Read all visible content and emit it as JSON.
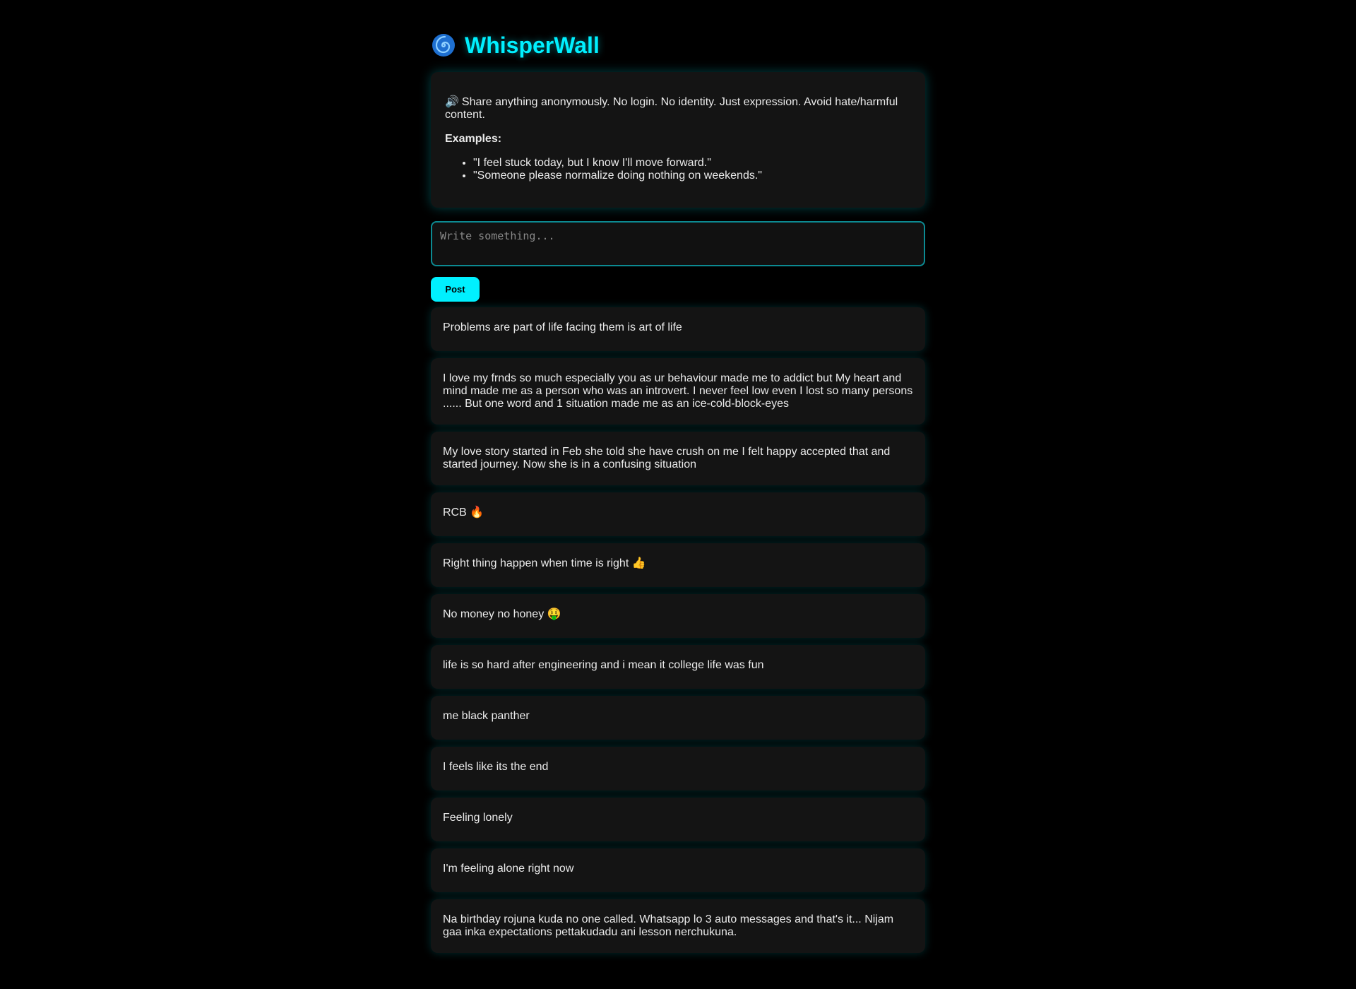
{
  "header": {
    "title": "WhisperWall",
    "logo_icon": "cyclone-icon"
  },
  "intro": {
    "description": "Share anything anonymously. No login. No identity. Just expression. Avoid hate/harmful content.",
    "description_icon": "speaker-icon",
    "examples_heading": "Examples:",
    "examples": [
      "\"I feel stuck today, but I know I'll move forward.\"",
      "\"Someone please normalize doing nothing on weekends.\""
    ]
  },
  "composer": {
    "value": "",
    "placeholder": "Write something...",
    "post_label": "Post"
  },
  "posts": [
    "Problems are part of life facing them is art of life",
    "I love my frnds so much especially you as ur behaviour made me to addict but My heart and mind made me as a person who was an introvert. I never feel low even I lost so many persons ...... But one word and 1 situation made me as an ice-cold-block-eyes",
    "My love story started in Feb she told she have crush on me I felt happy accepted that and started journey. Now she is in a confusing situation",
    "RCB 🔥",
    "Right thing happen when time is right 👍",
    "No money no honey 🤑",
    "life is so hard after engineering and i mean it college life was fun",
    "me black panther",
    "I feels like its the end",
    "Feeling lonely",
    "I'm feeling alone right now",
    "Na birthday rojuna kuda no one called. Whatsapp lo 3 auto messages and that's it... Nijam gaa inka expectations pettakudadu ani lesson nerchukuna."
  ],
  "colors": {
    "background": "#000000",
    "accent": "#00f0ff",
    "card": "#141414",
    "input_border": "#0c8a92"
  }
}
